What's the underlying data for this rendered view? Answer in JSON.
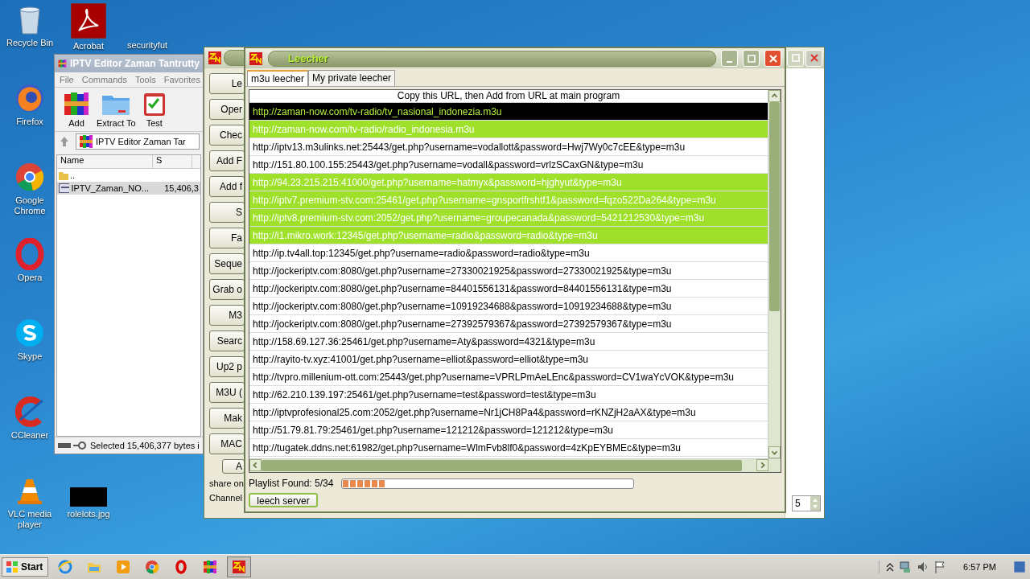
{
  "desktop_icons": [
    {
      "label": "Recycle Bin",
      "kind": "recycle"
    },
    {
      "label": "Firefox",
      "kind": "firefox"
    },
    {
      "label": "Google Chrome",
      "kind": "chrome"
    },
    {
      "label": "Opera",
      "kind": "opera"
    },
    {
      "label": "Skype",
      "kind": "skype"
    },
    {
      "label": "CCleaner",
      "kind": "ccleaner"
    },
    {
      "label": "VLC media player",
      "kind": "vlc"
    },
    {
      "label": "Acrobat",
      "kind": "acrobat"
    },
    {
      "label": "securityfut",
      "kind": "covered"
    },
    {
      "label": "rolelots.jpg",
      "kind": "image"
    }
  ],
  "winrar": {
    "title": "IPTV Editor Zaman Tantrutty",
    "menu": [
      "File",
      "Commands",
      "Tools",
      "Favorites"
    ],
    "toolbar": [
      {
        "label": "Add",
        "kind": "add"
      },
      {
        "label": "Extract To",
        "kind": "extract"
      },
      {
        "label": "Test",
        "kind": "test"
      }
    ],
    "path": "IPTV Editor Zaman Tar",
    "columns": [
      "Name",
      "S"
    ],
    "files": [
      {
        "name": "..",
        "kind": "folder",
        "selected": false
      },
      {
        "name": "IPTV_Zaman_NO...",
        "size": "15,406,3",
        "kind": "file",
        "selected": true
      }
    ],
    "status": "Selected 15,406,377 bytes i"
  },
  "iptv_editor": {
    "buttons": [
      "Le",
      "Oper",
      "Chec",
      "Add F",
      "Add f",
      "S",
      "Fa",
      "Seque",
      "Grab o",
      "M3",
      "Searc",
      "Up2 p",
      "M3U (",
      "Mak",
      "MAC",
      "A"
    ],
    "share_label": "share on",
    "channel_label": "Channel",
    "spinner_value": "5"
  },
  "leecher": {
    "title": "Leecher",
    "tabs": [
      {
        "label": "m3u leecher",
        "selected": true
      },
      {
        "label": "My private leecher",
        "selected": false
      }
    ],
    "header": "Copy this URL, then Add from URL at main program",
    "rows": [
      {
        "url": "http://zaman-now.com/tv-radio/tv_nasional_indonezia.m3u",
        "found": true,
        "selected": true
      },
      {
        "url": "http://zaman-now.com/tv-radio/radio_indonesia.m3u",
        "found": true,
        "selected": false
      },
      {
        "url": "http://iptv13.m3ulinks.net:25443/get.php?username=vodallott&password=Hwj7Wy0c7cEE&type=m3u",
        "found": false,
        "selected": false
      },
      {
        "url": "http://151.80.100.155:25443/get.php?username=vodall&password=vrlzSCaxGN&type=m3u",
        "found": false,
        "selected": false
      },
      {
        "url": "http://94.23.215.215:41000/get.php?username=hatmyx&password=hjghyut&type=m3u",
        "found": true,
        "selected": false
      },
      {
        "url": "http://iptv7.premium-stv.com:25461/get.php?username=gnsportfrshtf1&password=fqzo522Da264&type=m3u",
        "found": true,
        "selected": false
      },
      {
        "url": "http://iptv8.premium-stv.com:2052/get.php?username=groupecanada&password=5421212530&type=m3u",
        "found": true,
        "selected": false
      },
      {
        "url": "http://i1.mikro.work:12345/get.php?username=radio&password=radio&type=m3u",
        "found": true,
        "selected": false
      },
      {
        "url": "http://ip.tv4all.top:12345/get.php?username=radio&password=radio&type=m3u",
        "found": false,
        "selected": false
      },
      {
        "url": "http://jockeriptv.com:8080/get.php?username=27330021925&password=27330021925&type=m3u",
        "found": false,
        "selected": false
      },
      {
        "url": "http://jockeriptv.com:8080/get.php?username=84401556131&password=84401556131&type=m3u",
        "found": false,
        "selected": false
      },
      {
        "url": "http://jockeriptv.com:8080/get.php?username=10919234688&password=10919234688&type=m3u",
        "found": false,
        "selected": false
      },
      {
        "url": "http://jockeriptv.com:8080/get.php?username=27392579367&password=27392579367&type=m3u",
        "found": false,
        "selected": false
      },
      {
        "url": "http://158.69.127.36:25461/get.php?username=Aty&password=4321&type=m3u",
        "found": false,
        "selected": false
      },
      {
        "url": "http://rayito-tv.xyz:41001/get.php?username=elliot&password=elliot&type=m3u",
        "found": false,
        "selected": false
      },
      {
        "url": "http://tvpro.millenium-ott.com:25443/get.php?username=VPRLPmAeLEnc&password=CV1waYcVOK&type=m3u",
        "found": false,
        "selected": false
      },
      {
        "url": "http://62.210.139.197:25461/get.php?username=test&password=test&type=m3u",
        "found": false,
        "selected": false
      },
      {
        "url": "http://iptvprofesional25.com:2052/get.php?username=Nr1jCH8Pa4&password=rKNZjH2aAX&type=m3u",
        "found": false,
        "selected": false
      },
      {
        "url": "http://51.79.81.79:25461/get.php?username=121212&password=121212&type=m3u",
        "found": false,
        "selected": false
      },
      {
        "url": "http://tugatek.ddns.net:61982/get.php?username=WlmFvb8lf0&password=4zKpEYBMEc&type=m3u",
        "found": false,
        "selected": false
      }
    ],
    "status_label": "Playlist Found: 5/34",
    "progress": {
      "level": 0.15
    },
    "button": "leech server"
  },
  "taskbar": {
    "start": "Start",
    "apps": [
      {
        "kind": "ie",
        "active": false
      },
      {
        "kind": "explorer",
        "active": false
      },
      {
        "kind": "media",
        "active": false
      },
      {
        "kind": "chrome",
        "active": false
      },
      {
        "kind": "opera",
        "active": false
      },
      {
        "kind": "winrar",
        "active": false
      },
      {
        "kind": "zn",
        "active": true
      }
    ],
    "time": "6:57 PM"
  }
}
